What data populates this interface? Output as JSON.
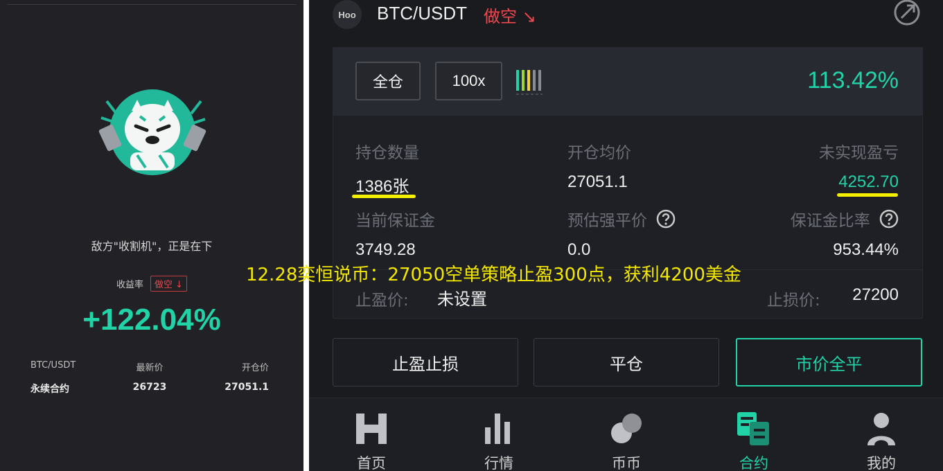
{
  "share_card": {
    "slogan": "敌方\"收割机\"，正是在下",
    "yield_label": "收益率",
    "direction_badge": "做空 ↓",
    "yield_rate": "+122.04%",
    "table": {
      "headers": [
        "BTC/USDT",
        "最新价",
        "开仓价"
      ],
      "values": [
        "永续合约",
        "26723",
        "27051.1"
      ]
    }
  },
  "app": {
    "logo_text": "Hoo",
    "pair": "BTC/USDT",
    "direction": "做空 ↘",
    "margin_mode": "全仓",
    "leverage": "100x",
    "roe": "113.42%",
    "fields": {
      "position_qty": {
        "label": "持仓数量",
        "value": "1386张"
      },
      "avg_open_price": {
        "label": "开仓均价",
        "value": "27051.1"
      },
      "unrealized_pnl": {
        "label": "未实现盈亏",
        "value": "4252.70"
      },
      "current_margin": {
        "label": "当前保证金",
        "value": "3749.28"
      },
      "est_liq_price": {
        "label": "预估强平价",
        "value": "0.0"
      },
      "margin_ratio": {
        "label": "保证金比率",
        "value": "953.44%"
      }
    },
    "take_profit": {
      "label": "止盈价:",
      "value": "未设置"
    },
    "stop_loss": {
      "label": "止损价:",
      "value": "27200"
    },
    "actions": [
      "止盈止损",
      "平仓",
      "市价全平"
    ],
    "tabs": [
      {
        "label": "首页",
        "icon": "home-icon"
      },
      {
        "label": "行情",
        "icon": "market-icon"
      },
      {
        "label": "币币",
        "icon": "spot-icon"
      },
      {
        "label": "合约",
        "icon": "contract-icon",
        "active": true
      },
      {
        "label": "我的",
        "icon": "profile-icon"
      }
    ]
  },
  "overlay_caption": "12.28奕恒说币：27050空单策略止盈300点，获利4200美金",
  "colors": {
    "accent_green": "#22d3a8",
    "short_red": "#f0484e",
    "highlight_yellow": "#f4f000",
    "caption_yellow": "#f4e800"
  }
}
